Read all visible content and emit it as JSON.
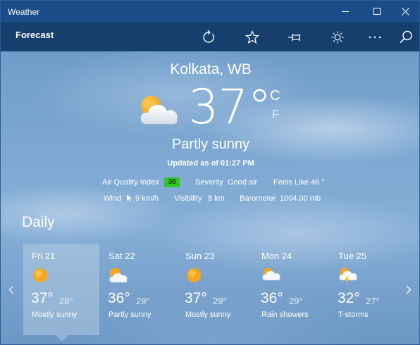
{
  "window": {
    "title": "Weather"
  },
  "header": {
    "section": "Forecast"
  },
  "current": {
    "city": "Kolkata, WB",
    "temperature": "37°",
    "unit_c": "C",
    "unit_f": "F",
    "condition": "Partly sunny",
    "updated": "Updated as of 01:27 PM",
    "icon": "partly-sunny-icon",
    "aqi_label": "Air Quality Index",
    "aqi_value": "36",
    "aqi_color": "#2ec72e",
    "severity_label": "Severity",
    "severity_value": "Good air",
    "feels_label": "Feels Like",
    "feels_value": "46 °",
    "wind_label": "Wind",
    "wind_value": "9 km/h",
    "visibility_label": "Visibility",
    "visibility_value": "8 km",
    "barometer_label": "Barometer",
    "barometer_value": "1004.00 mb"
  },
  "daily": {
    "title": "Daily",
    "days": [
      {
        "name": "Fri 21",
        "hi": "37°",
        "lo": "28°",
        "condition": "Mostly sunny",
        "icon": "sun-icon",
        "selected": true
      },
      {
        "name": "Sat 22",
        "hi": "36°",
        "lo": "29°",
        "condition": "Partly sunny",
        "icon": "partly-sunny-icon",
        "selected": false
      },
      {
        "name": "Sun 23",
        "hi": "37°",
        "lo": "29°",
        "condition": "Mostly sunny",
        "icon": "sun-icon",
        "selected": false
      },
      {
        "name": "Mon 24",
        "hi": "36°",
        "lo": "29°",
        "condition": "Rain showers",
        "icon": "rain-showers-icon",
        "selected": false
      },
      {
        "name": "Tue 25",
        "hi": "32°",
        "lo": "27°",
        "condition": "T-storms",
        "icon": "thunderstorm-icon",
        "selected": false
      }
    ]
  },
  "colors": {
    "titlebar": "#1b4e88",
    "appbar": "#163f6e",
    "sun": "#f5a623"
  }
}
